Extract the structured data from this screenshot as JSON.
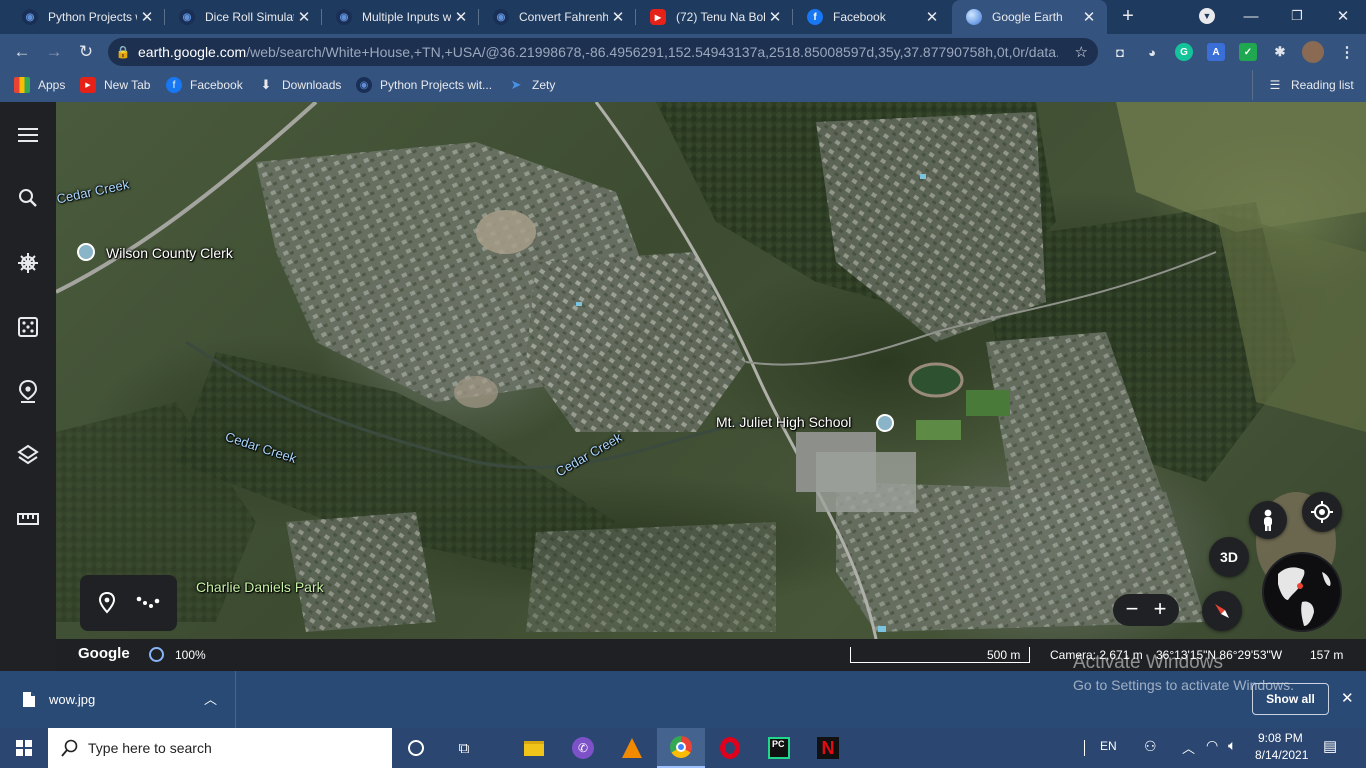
{
  "browser": {
    "tabs": [
      {
        "title": "Python Projects w",
        "icon": "python-projects-icon",
        "active": false
      },
      {
        "title": "Dice Roll Simulato",
        "icon": "python-projects-icon",
        "active": false
      },
      {
        "title": "Multiple Inputs w",
        "icon": "python-projects-icon",
        "active": false
      },
      {
        "title": "Convert Fahrenhe",
        "icon": "python-projects-icon",
        "active": false
      },
      {
        "title": "(72) Tenu Na Bol K",
        "icon": "youtube-icon",
        "active": false
      },
      {
        "title": "Facebook",
        "icon": "facebook-icon",
        "active": false
      },
      {
        "title": "Google Earth",
        "icon": "google-earth-icon",
        "active": true
      }
    ],
    "url_host": "earth.google.com",
    "url_path": "/web/search/White+House,+TN,+USA/@36.21998678,-86.4956291,152.54943137a,2518.85008597d,35y,37.87790758h,0t,0r/data...",
    "bookmarks": [
      {
        "label": "Apps",
        "icon": "apps-grid-icon"
      },
      {
        "label": "New Tab",
        "icon": "youtube-icon"
      },
      {
        "label": "Facebook",
        "icon": "facebook-icon"
      },
      {
        "label": "Downloads",
        "icon": "download-icon"
      },
      {
        "label": "Python Projects wit...",
        "icon": "python-projects-icon"
      },
      {
        "label": "Zety",
        "icon": "zety-icon"
      }
    ],
    "reading_list": "Reading list"
  },
  "earth": {
    "labels": {
      "cedar_creek_1": "Cedar Creek",
      "wilson_county_clerk": "Wilson County Clerk",
      "cedar_creek_2": "Cedar Creek",
      "cedar_creek_3": "Cedar Creek",
      "mt_juliet_high": "Mt. Juliet High School",
      "charlie_daniels_park": "Charlie Daniels Park"
    },
    "controls": {
      "three_d": "3D",
      "zoom_out": "−",
      "zoom_in": "+"
    },
    "status": {
      "google": "Google",
      "progress": "100%",
      "scale": "500 m",
      "camera": "Camera: 2,671 m",
      "coords": "36°13'15\"N 86°29'53\"W",
      "elevation": "157 m"
    },
    "activate": {
      "title": "Activate Windows",
      "subtitle": "Go to Settings to activate Windows."
    }
  },
  "downloads": {
    "file": "wow.jpg",
    "show_all": "Show all"
  },
  "taskbar": {
    "search_placeholder": "Type here to search",
    "language": "EN",
    "time": "9:08 PM",
    "date": "8/14/2021"
  },
  "colors": {
    "tabstrip": "#1f3a5f",
    "toolbar": "#35537f",
    "sidebar": "#202124",
    "taskbar": "#2b4670"
  }
}
